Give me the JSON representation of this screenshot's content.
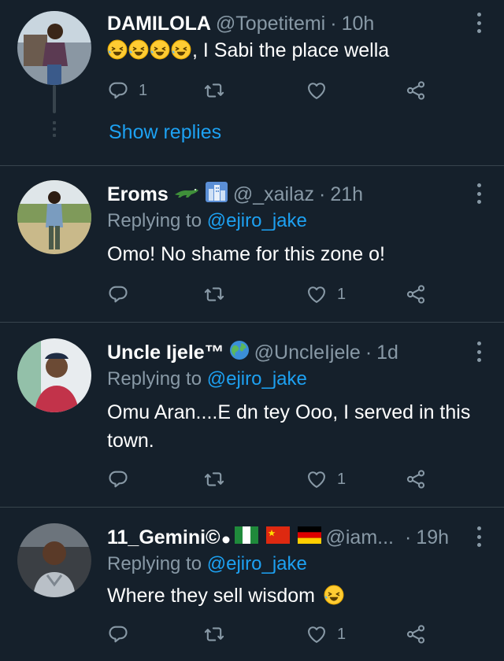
{
  "tweets": [
    {
      "name": "DAMILOLA",
      "handle": "@Topetitemi",
      "time": "10h",
      "body": ", I Sabi the place wella",
      "counts": {
        "reply": "1",
        "retweet": "",
        "like": ""
      }
    },
    {
      "name": "Eroms",
      "handle": "@_xailaz",
      "time": "21h",
      "replying_label": "Replying to",
      "replying_to": "@ejiro_jake",
      "body": "Omo! No shame for this zone o!",
      "counts": {
        "reply": "",
        "retweet": "",
        "like": "1"
      }
    },
    {
      "name": "Uncle Ijele™",
      "handle": "@UncleIjele",
      "time": "1d",
      "replying_label": "Replying to",
      "replying_to": "@ejiro_jake",
      "body": "Omu Aran....E dn tey Ooo, I served in this town.",
      "counts": {
        "reply": "",
        "retweet": "",
        "like": "1"
      }
    },
    {
      "name": "11_Gemini©",
      "handle": "@iam...",
      "time": "19h",
      "replying_label": "Replying to",
      "replying_to": "@ejiro_jake",
      "body": "Where they sell wisdom",
      "counts": {
        "reply": "",
        "retweet": "",
        "like": "1"
      }
    }
  ],
  "show_replies": "Show replies",
  "separator": "·",
  "colors": {
    "background": "#15202b",
    "divider": "#38444d",
    "muted": "#8899a6",
    "link": "#1da1f2",
    "emoji": "#ffcc33"
  },
  "icons": [
    "reply-icon",
    "retweet-icon",
    "like-icon",
    "share-icon",
    "more-icon",
    "laughing-emoji-icon",
    "crocodile-emoji-icon",
    "city-emoji-icon",
    "globe-emoji-icon",
    "nigeria-flag-icon",
    "china-flag-icon",
    "germany-flag-icon"
  ]
}
